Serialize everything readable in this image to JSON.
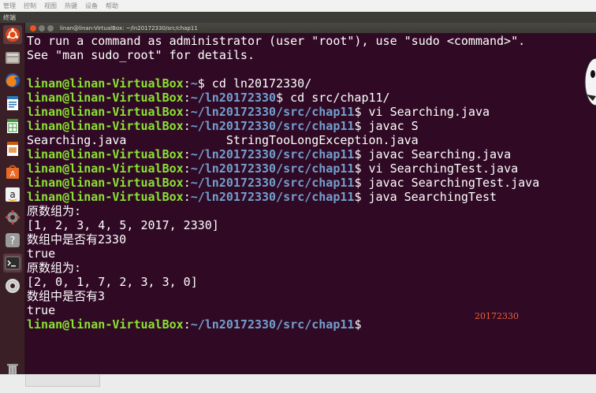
{
  "vbox_menu": [
    "管理",
    "控制",
    "视图",
    "热键",
    "设备",
    "帮助"
  ],
  "top_panel": {
    "title": "终端"
  },
  "window": {
    "title": "linan@linan-VirtualBox: ~/ln20172330/src/chap11"
  },
  "terminal": {
    "lines": [
      {
        "kind": "plain",
        "text": "To run a command as administrator (user \"root\"), use \"sudo <command>\"."
      },
      {
        "kind": "plain",
        "text": "See \"man sudo_root\" for details."
      },
      {
        "kind": "plain",
        "text": ""
      },
      {
        "kind": "prompt",
        "user": "linan@linan-VirtualBox",
        "path": "~",
        "cmd": "$ cd ln20172330/"
      },
      {
        "kind": "prompt",
        "user": "linan@linan-VirtualBox",
        "path": "~/ln20172330",
        "cmd": "$ cd src/chap11/"
      },
      {
        "kind": "prompt",
        "user": "linan@linan-VirtualBox",
        "path": "~/ln20172330/src/chap11",
        "cmd": "$ vi Searching.java"
      },
      {
        "kind": "prompt",
        "user": "linan@linan-VirtualBox",
        "path": "~/ln20172330/src/chap11",
        "cmd": "$ javac S"
      },
      {
        "kind": "plain",
        "text": "Searching.java              StringTooLongException.java"
      },
      {
        "kind": "prompt",
        "user": "linan@linan-VirtualBox",
        "path": "~/ln20172330/src/chap11",
        "cmd": "$ javac Searching.java"
      },
      {
        "kind": "prompt",
        "user": "linan@linan-VirtualBox",
        "path": "~/ln20172330/src/chap11",
        "cmd": "$ vi SearchingTest.java"
      },
      {
        "kind": "prompt",
        "user": "linan@linan-VirtualBox",
        "path": "~/ln20172330/src/chap11",
        "cmd": "$ javac SearchingTest.java"
      },
      {
        "kind": "prompt",
        "user": "linan@linan-VirtualBox",
        "path": "~/ln20172330/src/chap11",
        "cmd": "$ java SearchingTest"
      },
      {
        "kind": "plain",
        "text": "原数组为:"
      },
      {
        "kind": "plain",
        "text": "[1, 2, 3, 4, 5, 2017, 2330]"
      },
      {
        "kind": "plain",
        "text": "数组中是否有2330"
      },
      {
        "kind": "plain",
        "text": "true"
      },
      {
        "kind": "plain",
        "text": "原数组为:"
      },
      {
        "kind": "plain",
        "text": "[2, 0, 1, 7, 2, 3, 3, 0]"
      },
      {
        "kind": "plain",
        "text": "数组中是否有3"
      },
      {
        "kind": "plain",
        "text": "true"
      },
      {
        "kind": "prompt",
        "user": "linan@linan-VirtualBox",
        "path": "~/ln20172330/src/chap11",
        "cmd": "$ "
      }
    ]
  },
  "watermark": "20172330",
  "launcher": [
    "ubuntu-dash-icon",
    "files-icon",
    "firefox-icon",
    "writer-icon",
    "calc-icon",
    "impress-icon",
    "software-center-icon",
    "amazon-icon",
    "settings-icon",
    "help-icon",
    "terminal-icon",
    "dvd-icon",
    "trash-icon"
  ],
  "colors": {
    "terminal_bg": "#300a24",
    "user": "#8ae234",
    "path": "#729fcf",
    "text": "#ffffff",
    "launcher_bg": "#3a1f26",
    "watermark": "#e8613c"
  }
}
